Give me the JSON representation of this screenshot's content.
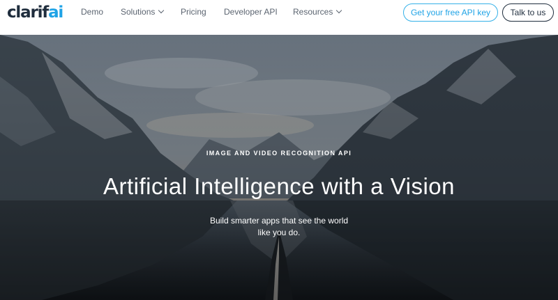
{
  "nav": {
    "logo_prefix": "clarif",
    "logo_suffix": "ai",
    "links": [
      "Demo",
      "Solutions",
      "Pricing",
      "Developer API",
      "Resources"
    ],
    "api_button": "Get your free API key",
    "talk_button": "Talk to us"
  },
  "hero": {
    "eyebrow": "IMAGE AND VIDEO RECOGNITION API",
    "headline": "Artificial Intelligence with a Vision",
    "subtitle": "Build smarter apps that see the world like you do."
  },
  "colors": {
    "brand_blue": "#1fa3e6",
    "brand_dark": "#1f2d3d"
  }
}
